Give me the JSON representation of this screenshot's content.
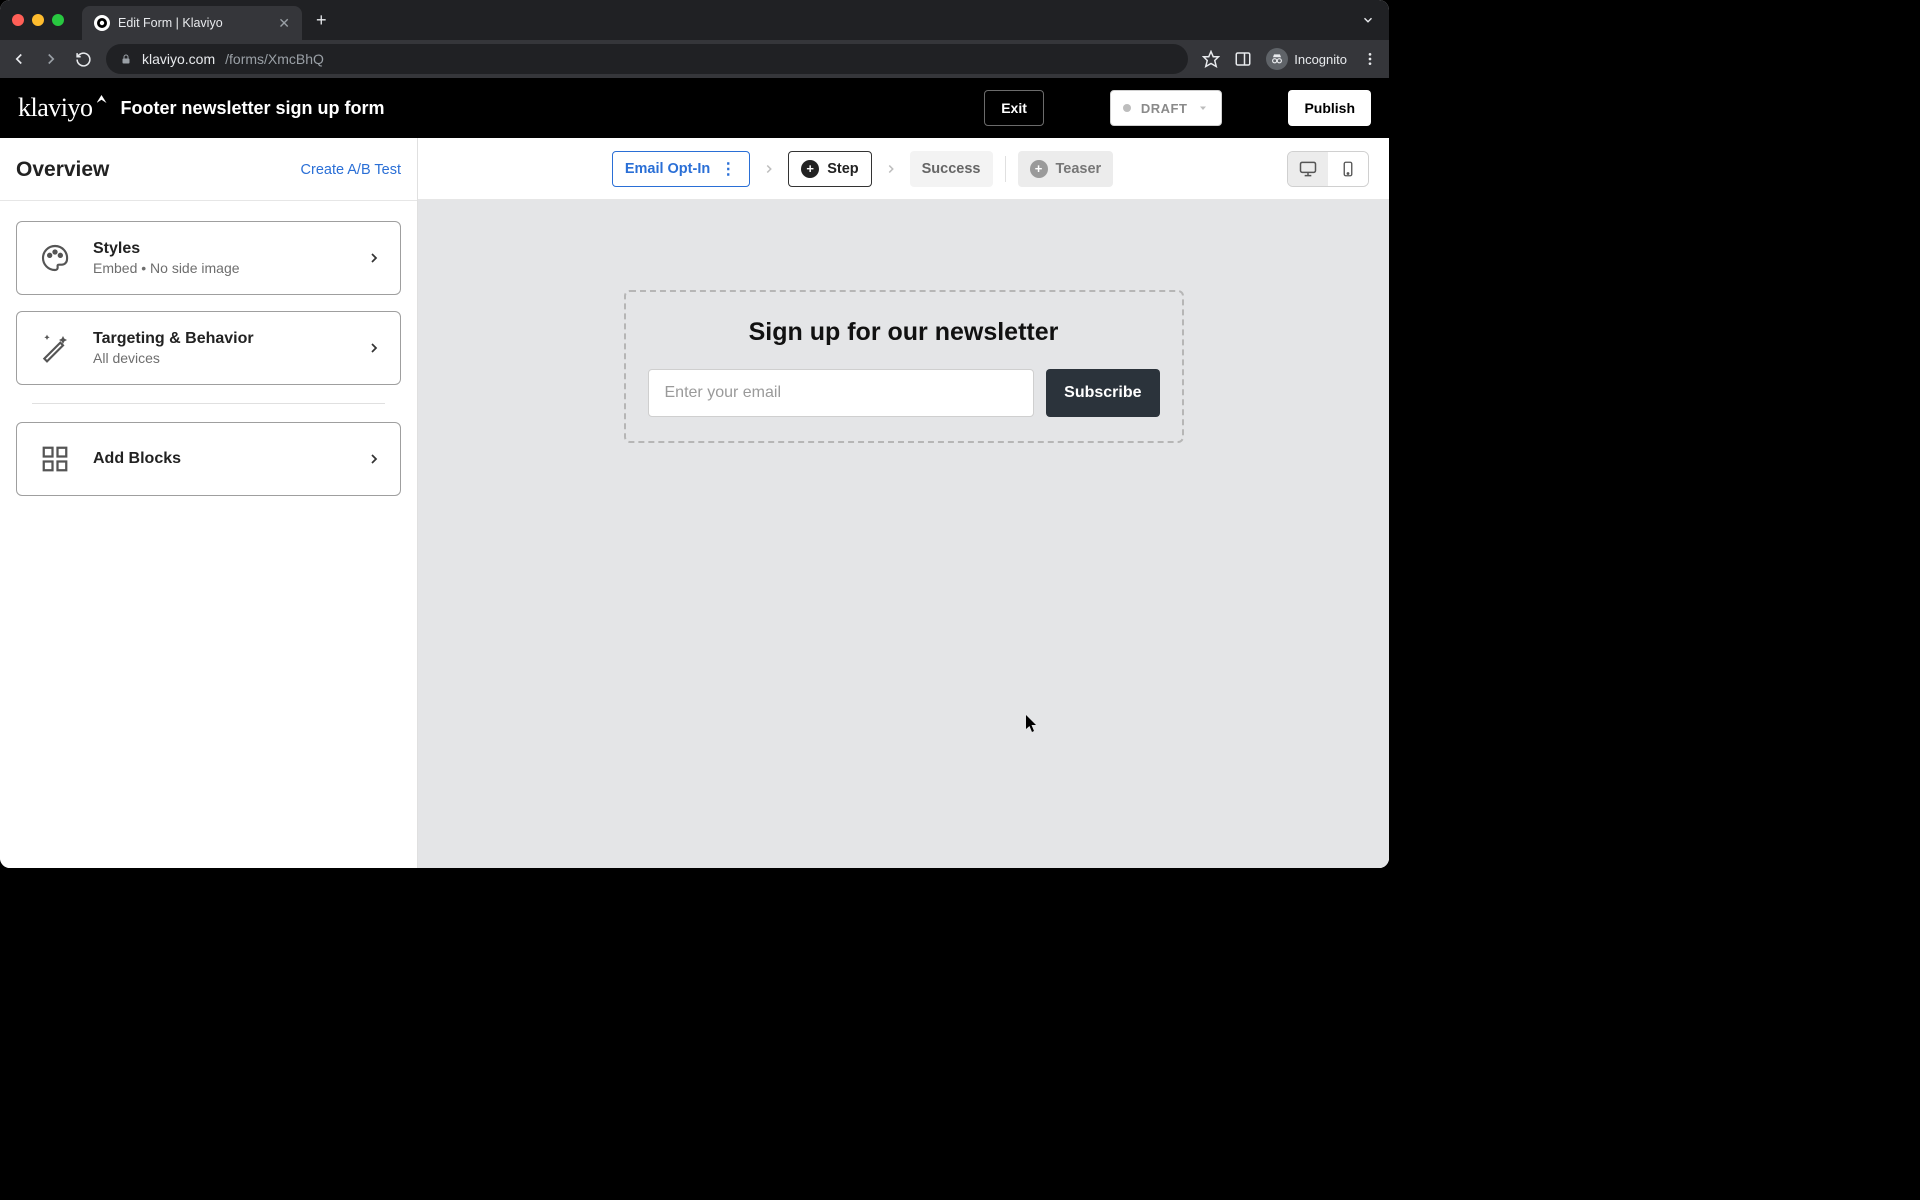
{
  "browser": {
    "tab_title": "Edit Form | Klaviyo",
    "url_host": "klaviyo.com",
    "url_path": "/forms/XmcBhQ",
    "incognito_label": "Incognito"
  },
  "header": {
    "logo_text": "klaviyo",
    "form_title": "Footer newsletter sign up form",
    "exit_label": "Exit",
    "status_label": "DRAFT",
    "publish_label": "Publish"
  },
  "sidebar": {
    "title": "Overview",
    "ab_link": "Create A/B Test",
    "cards": {
      "styles": {
        "title": "Styles",
        "sub": "Embed • No side image"
      },
      "targeting": {
        "title": "Targeting & Behavior",
        "sub": "All devices"
      },
      "blocks": {
        "title": "Add Blocks"
      }
    }
  },
  "steps": {
    "email_optin": "Email Opt-In",
    "add_step": "Step",
    "success": "Success",
    "teaser": "Teaser"
  },
  "preview": {
    "heading": "Sign up for our newsletter",
    "email_placeholder": "Enter your email",
    "subscribe_label": "Subscribe"
  }
}
